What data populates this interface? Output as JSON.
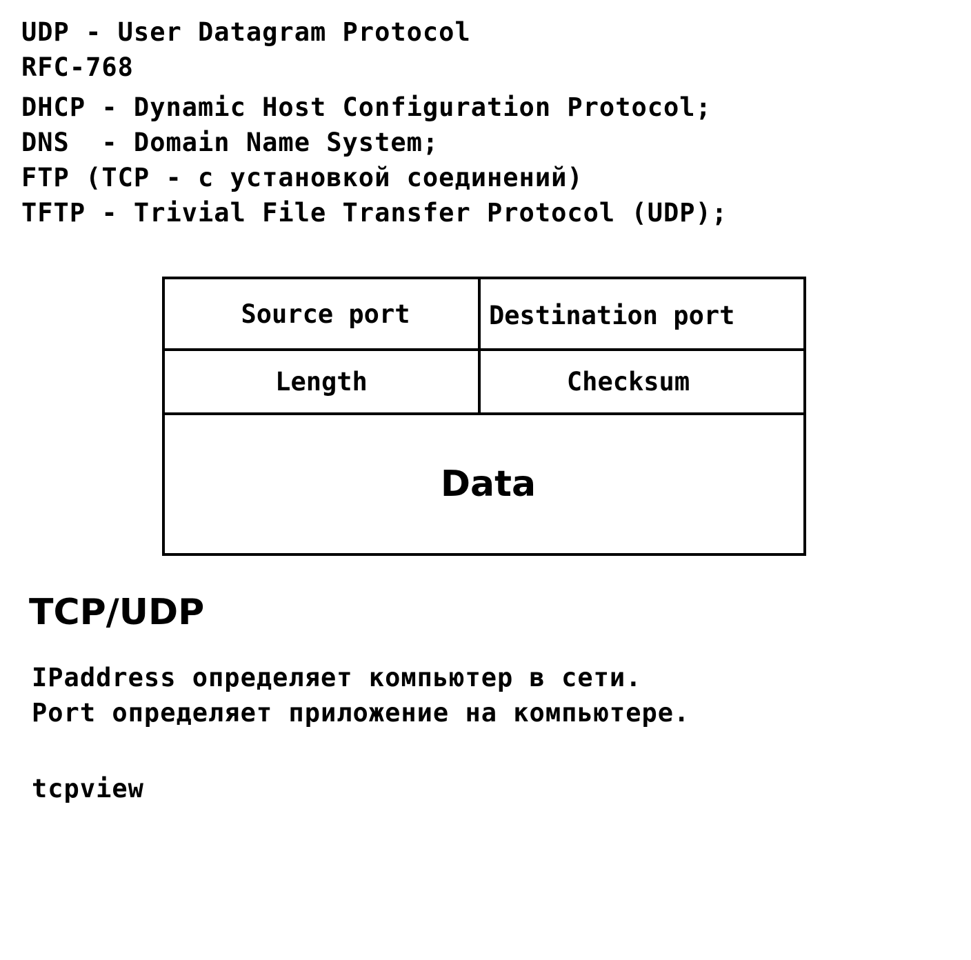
{
  "notes_top": [
    "UDP - User Datagram Protocol",
    "RFC-768",
    "DHCP - Dynamic Host Configuration Protocol;",
    "DNS  - Domain Name System;",
    "FTP (TCP - с установкой соединений)",
    "TFTP - Trivial File Transfer Protocol (UDP);"
  ],
  "udp_header": {
    "source_port": "Source port",
    "destination_port": "Destination port",
    "length": "Length",
    "checksum": "Checksum",
    "data": "Data"
  },
  "section_title": "TCP/UDP",
  "notes_bottom": [
    "IPaddress определяет компьютер в сети.",
    "Port определяет приложение на компьютере."
  ],
  "tool_name": "tcpview"
}
